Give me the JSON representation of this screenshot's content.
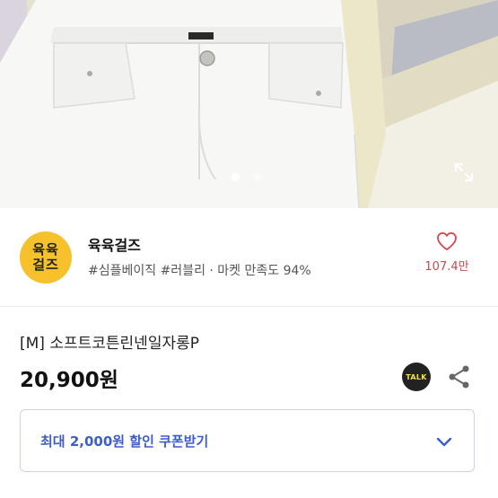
{
  "hero": {
    "image_name": "white-jeans-product-photo",
    "icons": {
      "expand": "expand-arrows-icon"
    },
    "carousel": {
      "count": 2,
      "active_index": 0
    }
  },
  "shop": {
    "logo_text_line1": "육육",
    "logo_text_line2": "걸즈",
    "name": "육육걸즈",
    "tags": "#심플베이직 #러블리 · 마켓 만족도 94%",
    "like_count": "107.4만",
    "icons": {
      "like": "heart-outline-icon"
    }
  },
  "product": {
    "title": "[M] 소프트코튼린넨일자롱P",
    "price": "20,900원",
    "talk_label": "TALK",
    "icons": {
      "talk": "kakao-talk-icon",
      "share": "share-icon"
    }
  },
  "coupon": {
    "label": "최대 2,000원 할인 쿠폰받기",
    "icons": {
      "expand": "chevron-down-icon"
    }
  },
  "colors": {
    "accent_blue": "#3c5dcb",
    "like_red": "#d2484e",
    "logo_yellow": "#f6c12c"
  }
}
